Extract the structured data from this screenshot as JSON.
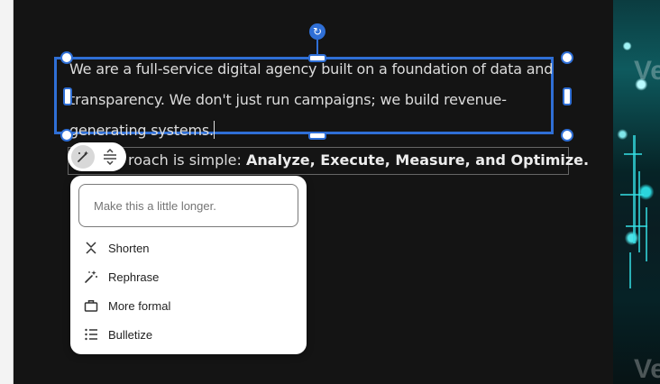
{
  "slide": {
    "textbox_text": "We are a full-service digital agency built on a foundation of data and transparency. We don't just run campaigns; we build revenue-generating systems.",
    "approach_prefix": "roach is simple: ",
    "approach_bold": "Analyze, Execute, Measure, and Optimize."
  },
  "right_image": {
    "ghost_top": "Ve",
    "ghost_bottom": "Ve"
  },
  "mini_toolbar": {
    "magic_icon": "magic-wand-icon",
    "format_icon": "line-spacing-icon"
  },
  "panel": {
    "prompt_placeholder": "Make this a little longer.",
    "items": [
      {
        "label": "Shorten",
        "icon": "shorten-icon"
      },
      {
        "label": "Rephrase",
        "icon": "sparkle-wand-icon"
      },
      {
        "label": "More formal",
        "icon": "briefcase-icon"
      },
      {
        "label": "Bulletize",
        "icon": "bullet-list-icon"
      }
    ]
  },
  "colors": {
    "selection_blue": "#2f6fd6",
    "slide_bg": "#141414",
    "text": "#dcdcdc"
  }
}
